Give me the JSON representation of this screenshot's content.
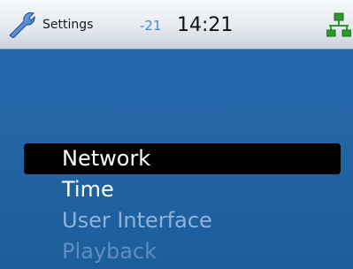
{
  "status_bar": {
    "app_title": "Settings",
    "signal_value": "-21",
    "time": "14:21",
    "icons": [
      "wrench-icon",
      "network-icon"
    ]
  },
  "menu": {
    "selected_index": 0,
    "items": [
      {
        "label": "Network"
      },
      {
        "label": "Time"
      },
      {
        "label": "User Interface"
      },
      {
        "label": "Playback"
      }
    ]
  },
  "colors": {
    "background": "#1f68ac",
    "statusbar": "#eef2f5",
    "selection": "#000000",
    "icon_green": "#2e9a2e",
    "icon_blue": "#3a6fc8"
  }
}
